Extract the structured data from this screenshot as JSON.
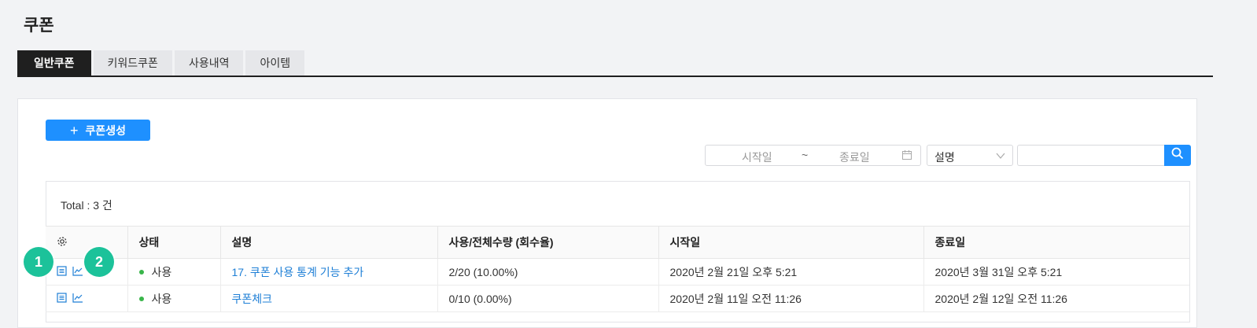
{
  "page": {
    "title": "쿠폰"
  },
  "tabs": [
    {
      "label": "일반쿠폰",
      "active": true
    },
    {
      "label": "키워드쿠폰",
      "active": false
    },
    {
      "label": "사용내역",
      "active": false
    },
    {
      "label": "아이템",
      "active": false
    }
  ],
  "toolbar": {
    "create_label": "쿠폰생성"
  },
  "filters": {
    "start_placeholder": "시작일",
    "separator": "~",
    "end_placeholder": "종료일",
    "select_value": "설명",
    "search_value": ""
  },
  "summary": {
    "total_text": "Total : 3 건"
  },
  "table": {
    "headers": [
      "",
      "상태",
      "설명",
      "사용/전체수량 (회수율)",
      "시작일",
      "종료일"
    ],
    "rows": [
      {
        "status": "사용",
        "description": "17. 쿠폰 사용 통계 기능 추가",
        "usage": "2/20 (10.00%)",
        "start": "2020년 2월 21일 오후 5:21",
        "end": "2020년 3월 31일 오후 5:21"
      },
      {
        "status": "사용",
        "description": "쿠폰체크",
        "usage": "0/10 (0.00%)",
        "start": "2020년 2월 11일 오전 11:26",
        "end": "2020년 2월 12일 오전 11:26"
      }
    ]
  },
  "annotations": {
    "badge1": "1",
    "badge2": "2"
  },
  "colors": {
    "accent": "#1e90ff",
    "badge": "#1cc29a",
    "status_dot": "#39b54a",
    "tab_active": "#1f1f1f"
  },
  "icons": [
    "settings-gear-icon",
    "detail-list-icon",
    "chart-line-icon",
    "calendar-icon",
    "chevron-down-icon",
    "search-icon",
    "plus-icon"
  ]
}
